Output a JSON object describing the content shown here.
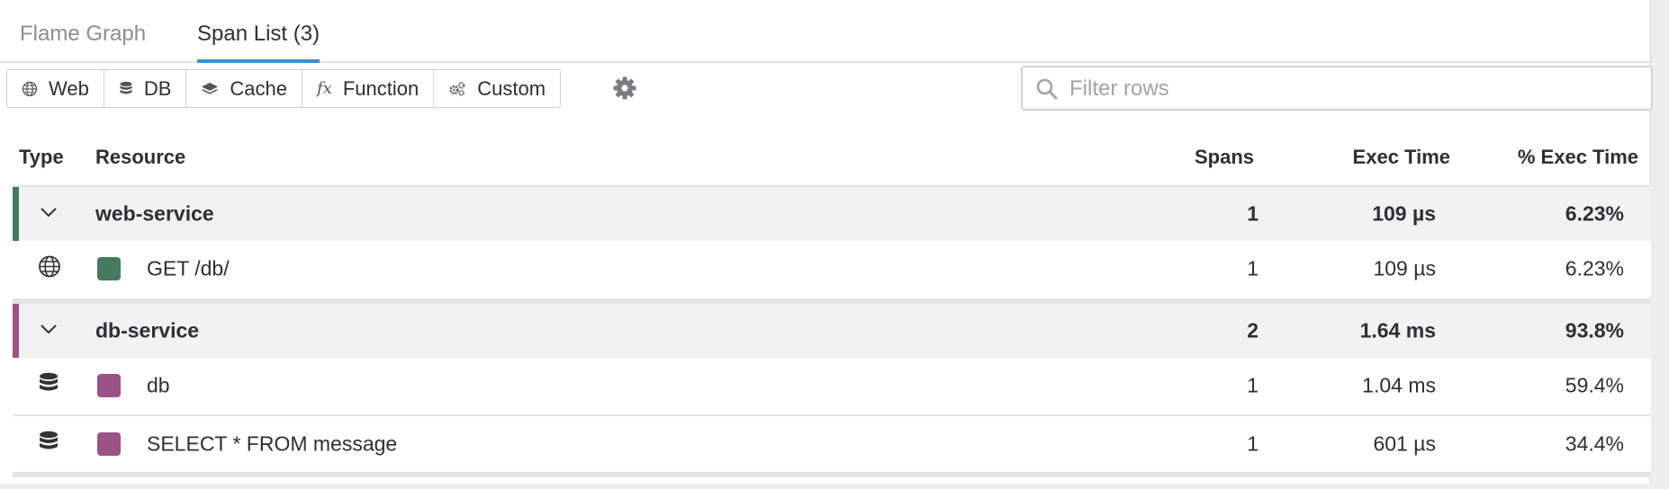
{
  "tabs": [
    {
      "label": "Flame Graph",
      "active": false
    },
    {
      "label": "Span List (3)",
      "active": true
    }
  ],
  "filters": [
    {
      "label": "Web",
      "icon": "globe-icon"
    },
    {
      "label": "DB",
      "icon": "database-icon"
    },
    {
      "label": "Cache",
      "icon": "layers-icon"
    },
    {
      "label": "Function",
      "icon": "fx-icon",
      "glyph": "fx"
    },
    {
      "label": "Custom",
      "icon": "gears-icon"
    }
  ],
  "search": {
    "placeholder": "Filter rows",
    "value": ""
  },
  "table": {
    "headers": {
      "type": "Type",
      "resource": "Resource",
      "spans": "Spans",
      "exec": "Exec Time",
      "pct": "% Exec Time"
    },
    "groups": [
      {
        "name": "web-service",
        "spans": "1",
        "exec": "109 µs",
        "pct": "6.23%",
        "color": "#477a5c",
        "rows": [
          {
            "icon": "globe-icon",
            "resource": "GET /db/",
            "spans": "1",
            "exec": "109 µs",
            "pct": "6.23%",
            "color": "#477a5c"
          }
        ]
      },
      {
        "name": "db-service",
        "spans": "2",
        "exec": "1.64 ms",
        "pct": "93.8%",
        "color": "#9b5385",
        "rows": [
          {
            "icon": "database-icon",
            "resource": "db",
            "spans": "1",
            "exec": "1.04 ms",
            "pct": "59.4%",
            "color": "#9b5385"
          },
          {
            "icon": "database-icon",
            "resource": "SELECT * FROM message",
            "spans": "1",
            "exec": "601 µs",
            "pct": "34.4%",
            "color": "#9b5385"
          }
        ]
      }
    ]
  }
}
